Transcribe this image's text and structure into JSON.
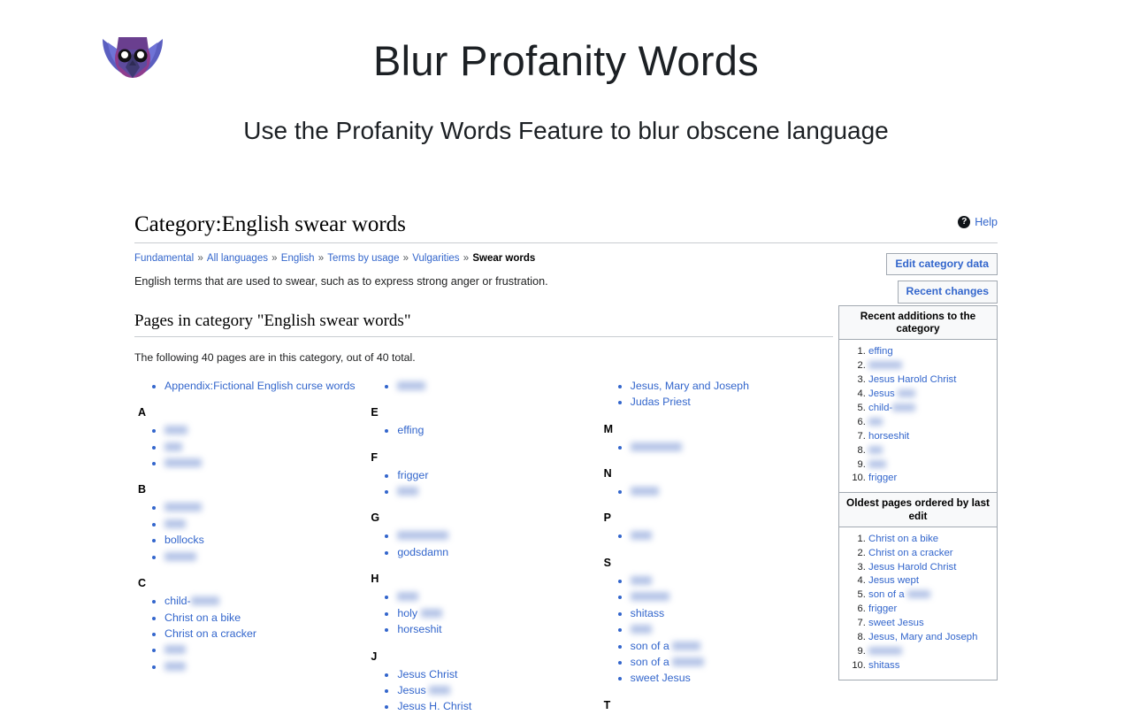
{
  "promo": {
    "title": "Blur Profanity Words",
    "subtitle": "Use the Profanity Words Feature to blur obscene language",
    "logo_icon": "owl-logo-icon"
  },
  "page": {
    "help_label": "Help",
    "help_icon": "question-mark-icon",
    "category_title": "Category:English swear words",
    "description": "English terms that are used to swear, such as to express strong anger or frustration.",
    "breadcrumb": [
      {
        "label": "Fundamental",
        "current": false
      },
      {
        "label": "All languages",
        "current": false
      },
      {
        "label": "English",
        "current": false
      },
      {
        "label": "Terms by usage",
        "current": false
      },
      {
        "label": "Vulgarities",
        "current": false
      },
      {
        "label": "Swear words",
        "current": true
      }
    ],
    "breadcrumb_separator": "»",
    "buttons": {
      "edit_category_data": "Edit category data",
      "recent_changes": "Recent changes"
    },
    "pages_heading": "Pages in category \"English swear words\"",
    "pages_note": "The following 40 pages are in this category, out of 40 total."
  },
  "lead_item": "Appendix:Fictional English curse words",
  "columns": [
    {
      "groups": [
        {
          "letter": "A",
          "items": [
            {
              "text": "",
              "blur": "w1"
            },
            {
              "text": "",
              "blur": "w2"
            },
            {
              "text": "",
              "blur": "w4"
            }
          ]
        },
        {
          "letter": "B",
          "items": [
            {
              "text": "",
              "blur": "w4"
            },
            {
              "text": "",
              "blur": "w8"
            },
            {
              "text": "bollocks",
              "blur": null
            },
            {
              "text": "",
              "blur": "w6"
            }
          ]
        },
        {
          "letter": "C",
          "items": [
            {
              "text": "child-",
              "blur": "w5"
            },
            {
              "text": "Christ on a bike",
              "blur": null
            },
            {
              "text": "Christ on a cracker",
              "blur": null
            },
            {
              "text": "",
              "blur": "w8"
            },
            {
              "text": "",
              "blur": "w8"
            }
          ]
        }
      ]
    },
    {
      "groups": [
        {
          "letter": "",
          "items": [
            {
              "text": "",
              "blur": "w5"
            }
          ]
        },
        {
          "letter": "E",
          "items": [
            {
              "text": "effing",
              "blur": null
            }
          ]
        },
        {
          "letter": "F",
          "items": [
            {
              "text": "frigger",
              "blur": null
            },
            {
              "text": "",
              "blur": "w8"
            }
          ]
        },
        {
          "letter": "G",
          "items": [
            {
              "text": "",
              "blur": "w7"
            },
            {
              "text": "godsdamn",
              "blur": null
            }
          ]
        },
        {
          "letter": "H",
          "items": [
            {
              "text": "",
              "blur": "w8"
            },
            {
              "text": "holy ",
              "blur": "w8"
            },
            {
              "text": "horseshit",
              "blur": null
            }
          ]
        },
        {
          "letter": "J",
          "items": [
            {
              "text": "Jesus Christ",
              "blur": null
            },
            {
              "text": "Jesus ",
              "blur": "w8"
            },
            {
              "text": "Jesus H. Christ",
              "blur": null
            }
          ]
        }
      ]
    },
    {
      "groups": [
        {
          "letter": "",
          "items": [
            {
              "text": "Jesus, Mary and Joseph",
              "blur": null
            },
            {
              "text": "Judas Priest",
              "blur": null
            }
          ]
        },
        {
          "letter": "M",
          "items": [
            {
              "text": "",
              "blur": "w7"
            }
          ]
        },
        {
          "letter": "N",
          "items": [
            {
              "text": "",
              "blur": "w5"
            }
          ]
        },
        {
          "letter": "P",
          "items": [
            {
              "text": "",
              "blur": "w8"
            }
          ]
        },
        {
          "letter": "S",
          "items": [
            {
              "text": "",
              "blur": "w8"
            },
            {
              "text": "",
              "blur": "w3"
            },
            {
              "text": "shitass",
              "blur": null
            },
            {
              "text": "",
              "blur": "w8"
            },
            {
              "text": "son of a ",
              "blur": "w5"
            },
            {
              "text": "son of a ",
              "blur": "w6"
            },
            {
              "text": "sweet Jesus",
              "blur": null
            }
          ]
        },
        {
          "letter": "T",
          "items": []
        }
      ]
    }
  ],
  "sidebar": [
    {
      "title": "Recent additions to the category",
      "items": [
        {
          "text": "effing",
          "blur": null
        },
        {
          "text": "",
          "blur": "s3"
        },
        {
          "text": "Jesus Harold Christ",
          "blur": null
        },
        {
          "text": "Jesus ",
          "blur": "s2"
        },
        {
          "text": "child-",
          "blur": "s5"
        },
        {
          "text": "",
          "blur": "s4"
        },
        {
          "text": "horseshit",
          "blur": null
        },
        {
          "text": "",
          "blur": "s4"
        },
        {
          "text": "",
          "blur": "s2"
        },
        {
          "text": "frigger",
          "blur": null
        }
      ]
    },
    {
      "title": "Oldest pages ordered by last edit",
      "items": [
        {
          "text": "Christ on a bike",
          "blur": null
        },
        {
          "text": "Christ on a cracker",
          "blur": null
        },
        {
          "text": "Jesus Harold Christ",
          "blur": null
        },
        {
          "text": "Jesus wept",
          "blur": null
        },
        {
          "text": "son of a ",
          "blur": "s5"
        },
        {
          "text": "frigger",
          "blur": null
        },
        {
          "text": "sweet Jesus",
          "blur": null
        },
        {
          "text": "Jesus, Mary and Joseph",
          "blur": null
        },
        {
          "text": "",
          "blur": "s3"
        },
        {
          "text": "shitass",
          "blur": null
        }
      ]
    }
  ],
  "colors": {
    "link": "#3366cc",
    "border": "#a2a9b1",
    "rule": "#c8ccd1",
    "blur_chip": "#9fb3e0"
  }
}
